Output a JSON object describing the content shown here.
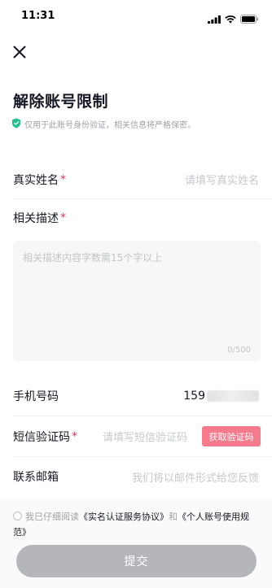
{
  "status_bar": {
    "time": "11:31"
  },
  "page": {
    "title": "解除账号限制",
    "privacy_note": "仅用于此账号身份验证，相关信息将严格保密。"
  },
  "form": {
    "real_name": {
      "label": "真实姓名",
      "required_mark": "*",
      "placeholder": "请填写真实姓名"
    },
    "description": {
      "label": "相关描述",
      "required_mark": "*",
      "placeholder": "相关描述内容字数需15个字以上",
      "counter": "0/500"
    },
    "phone": {
      "label": "手机号码",
      "value_prefix": "159"
    },
    "sms_code": {
      "label": "短信验证码",
      "required_mark": "*",
      "placeholder": "请填写短信验证码",
      "get_code_button": "获取验证码"
    },
    "email": {
      "label": "联系邮箱",
      "placeholder": "我们将以邮件形式给您反馈"
    }
  },
  "agreement": {
    "prefix": "我已仔细阅读",
    "link1": "《实名认证服务协议》",
    "joiner": "和",
    "link2": "《个人账号使用规范》"
  },
  "submit_button": {
    "label": "提交"
  },
  "colors": {
    "accent": "#fe2c55",
    "sms_button": "#f57b8c",
    "submit_disabled": "#b5b6ba",
    "shield_green": "#20c18e"
  }
}
